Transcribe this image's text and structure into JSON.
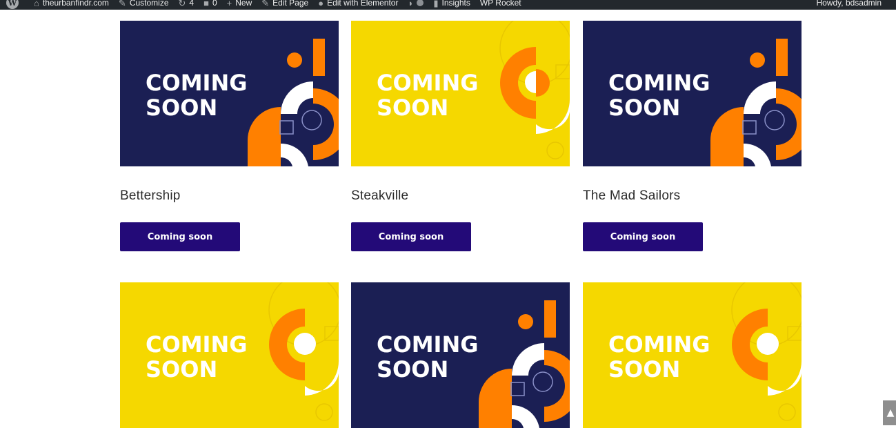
{
  "adminbar": {
    "site_name": "theurbanfindr.com",
    "customize": "Customize",
    "updates_count": "4",
    "comments_count": "0",
    "new": "New",
    "edit_page": "Edit Page",
    "edit_elementor": "Edit with Elementor",
    "insights": "Insights",
    "wp_rocket": "WP Rocket",
    "howdy": "Howdy, bdsadmin"
  },
  "thumb_text": {
    "line1": "COMING",
    "line2": "SOON"
  },
  "colors": {
    "navy": "#1b1f54",
    "yellow": "#f5d800",
    "orange": "#ff8000",
    "button": "#230a78"
  },
  "cards": [
    {
      "title": "Bettership",
      "button": "Coming soon",
      "theme": "navy"
    },
    {
      "title": "Steakville",
      "button": "Coming soon",
      "theme": "yellow"
    },
    {
      "title": "The Mad Sailors",
      "button": "Coming soon",
      "theme": "navy"
    },
    {
      "title": "",
      "button": "",
      "theme": "yellow"
    },
    {
      "title": "",
      "button": "",
      "theme": "navy"
    },
    {
      "title": "",
      "button": "",
      "theme": "yellow"
    }
  ]
}
